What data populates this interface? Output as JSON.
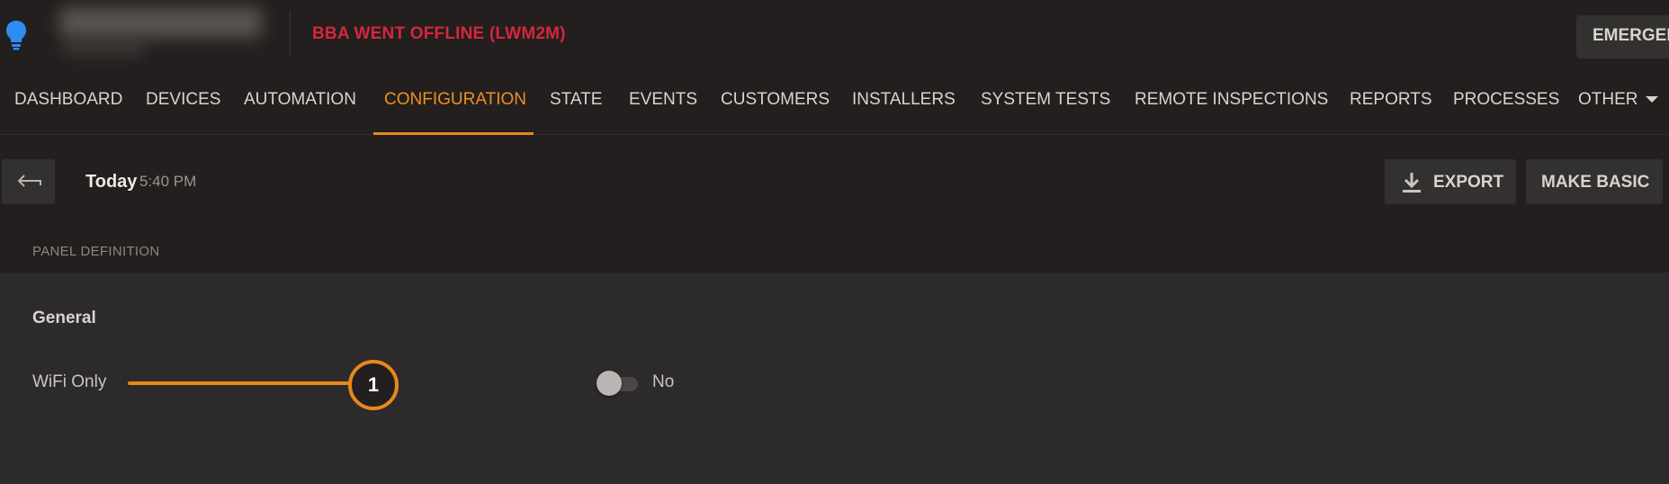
{
  "header": {
    "alert": "BBA WENT OFFLINE (LWM2M)",
    "emergency_label": "EMERGEN",
    "colors": {
      "alert": "#d7263d",
      "accent": "#e8871c",
      "bulb": "#2f8cf0"
    }
  },
  "nav": {
    "tabs": [
      {
        "label": "DASHBOARD"
      },
      {
        "label": "DEVICES"
      },
      {
        "label": "AUTOMATION"
      },
      {
        "label": "CONFIGURATION",
        "active": true
      },
      {
        "label": "STATE"
      },
      {
        "label": "EVENTS"
      },
      {
        "label": "CUSTOMERS"
      },
      {
        "label": "INSTALLERS"
      },
      {
        "label": "SYSTEM TESTS"
      },
      {
        "label": "REMOTE INSPECTIONS"
      },
      {
        "label": "REPORTS"
      },
      {
        "label": "PROCESSES"
      },
      {
        "label": "OTHER"
      }
    ]
  },
  "toolbar": {
    "back_icon": "arrow-left-icon",
    "date_label": "Today",
    "time_label": "5:40 PM",
    "export_label": "EXPORT",
    "export_icon": "download-icon",
    "make_basic_label": "MAKE BASIC"
  },
  "section": {
    "label": "PANEL DEFINITION"
  },
  "panel": {
    "title": "General",
    "rows": [
      {
        "label": "WiFi Only",
        "callout": "1",
        "toggle_on": false,
        "value_label": "No"
      }
    ]
  }
}
